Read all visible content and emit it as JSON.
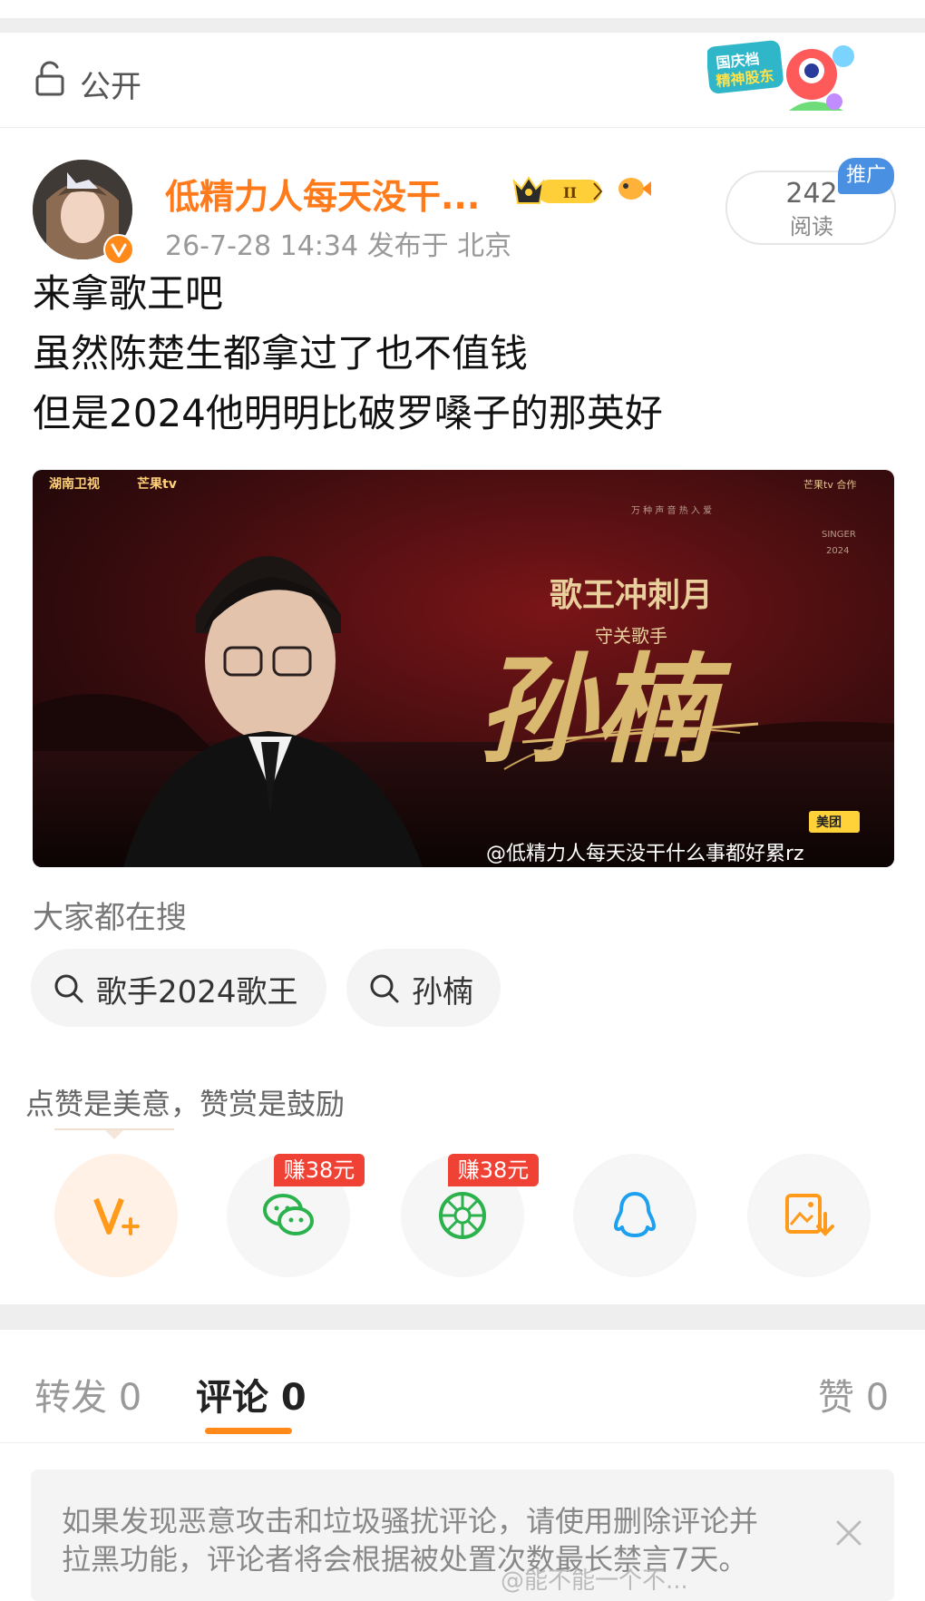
{
  "visibility": {
    "label": "公开"
  },
  "post": {
    "author": "低精力人每天没干...",
    "time_location": "26-7-28 14:34  发布于 北京",
    "read_count": "242",
    "read_label": "阅读",
    "promo_tag": "推广",
    "lines": [
      "来拿歌王吧",
      "虽然陈楚生都拿过了也不值钱",
      "但是2024他明明比破罗嗓子的那英好"
    ],
    "image": {
      "logo_hunan": "湖南卫视",
      "logo_mango": "芒果tv",
      "corner_logo": "芒果tv 合作",
      "subtitle_small": "万 种 声 音   热 入 爱",
      "singer_label": "SINGER",
      "year_label": "2024",
      "headline": "歌王冲刺月",
      "role": "守关歌手",
      "name": "孙楠",
      "sponsor": "美团",
      "watermark": "@低精力人每天没干什么事都好累rz"
    }
  },
  "search": {
    "title": "大家都在搜",
    "chips": [
      "歌手2024歌王",
      "孙楠"
    ]
  },
  "share": {
    "hint": "点赞是美意，赞赏是鼓励",
    "earn_wechat": "赚38元",
    "earn_moments": "赚38元",
    "icons": [
      "v-plus-icon",
      "wechat-icon",
      "moments-icon",
      "qq-icon",
      "save-image-icon"
    ]
  },
  "tabs": [
    {
      "label": "转发 0"
    },
    {
      "label": "评论 0"
    },
    {
      "label": "赞 0"
    }
  ],
  "notice": {
    "line1": "如果发现恶意攻击和垃圾骚扰评论，请使用删除评论并",
    "line2": "拉黑功能，评论者将会根据被处置次数最长禁言7天。"
  },
  "footer_watermark": "@能不能一个不...",
  "colors": {
    "accent": "#ff8a1a",
    "author": "#ff7a1a",
    "earn": "#f04135",
    "promo": "#4a90e2"
  }
}
